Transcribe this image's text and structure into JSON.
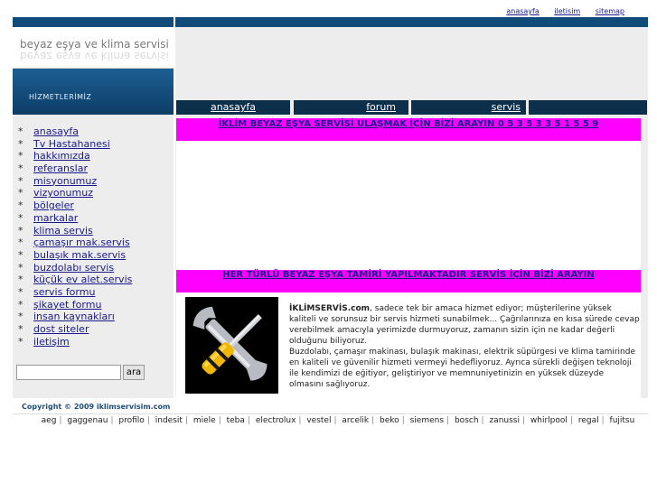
{
  "top_links": [
    "anasayfa",
    "iletisim",
    "sitemap"
  ],
  "logo": {
    "title": "beyaz eşya ve klima servisi"
  },
  "hizmetlerimiz_label": "HİZMETLERİMİZ",
  "nav_tabs": [
    "anasayfa",
    "forum",
    "servis",
    ""
  ],
  "menu_star": "*",
  "menu": [
    "anasayfa",
    "Tv Hastahanesi",
    "hakkımızda",
    "referanslar",
    "misyonumuz",
    "vizyonumuz",
    "bölgeler",
    "markalar",
    "klima servis",
    "çamaşır mak.servis",
    "bulaşık mak.servis",
    "buzdolabı servis",
    "küçük ev alet.servis",
    "servis formu",
    "şikayet formu",
    "insan kaynakları",
    "dost siteler",
    "iletişim"
  ],
  "search": {
    "button_label": "ara",
    "value": ""
  },
  "banner_top": "İKLİM BEYAZ EŞYA SERVİSİ ULAŞMAK İÇİN BİZİ ARAYIN 0 5 3 5  3 3 5   1 5  5 9",
  "banner_mid": "HER TÜRLÜ BEYAZ EŞYA TAMİRİ YAPILMAKTADIR SERVİS İÇİN BİZİ ARAYIN",
  "content": {
    "brand": "İKLİMSERVİS.com",
    "paragraph1": ", sadece tek bir amaca hizmet ediyor; müşterilerine yüksek kaliteli ve sorunsuz bir servis  hizmeti sunabilmek... Çağrılarınıza en kısa sürede cevap verebilmek amacıyla yerimizde durmuyoruz, zamanın sizin için ne kadar değerli olduğunu biliyoruz.",
    "paragraph2": "Buzdolabı, çamaşır makinası, bulaşık makinası, elektrik süpürgesi ve klima tamirinde en kaliteli ve güvenilir hizmeti vermeyi hedefliyoruz. Ayrıca sürekli değişen teknoloji ile kendimizi de eğitiyor, geliştiriyor ve memnuniyetinizin en yüksek düzeyde olmasını sağlıyoruz."
  },
  "copyright": "Copyright © 2009 iklimservisim.com",
  "brands": [
    "aeg",
    "gaggenau",
    "profilo",
    "indesit",
    "miele",
    "teba",
    "electrolux",
    "vestel",
    "arcelik",
    "beko",
    "siemens",
    "bosch",
    "zanussi",
    "whirlpool",
    "regal",
    "fujitsu"
  ],
  "colors": {
    "header_blue": "#0f4c7a",
    "nav_dark": "#0c2f4b",
    "banner_magenta": "#ff00ff",
    "link": "#1a1a8c",
    "panel_grey": "#ededed"
  }
}
